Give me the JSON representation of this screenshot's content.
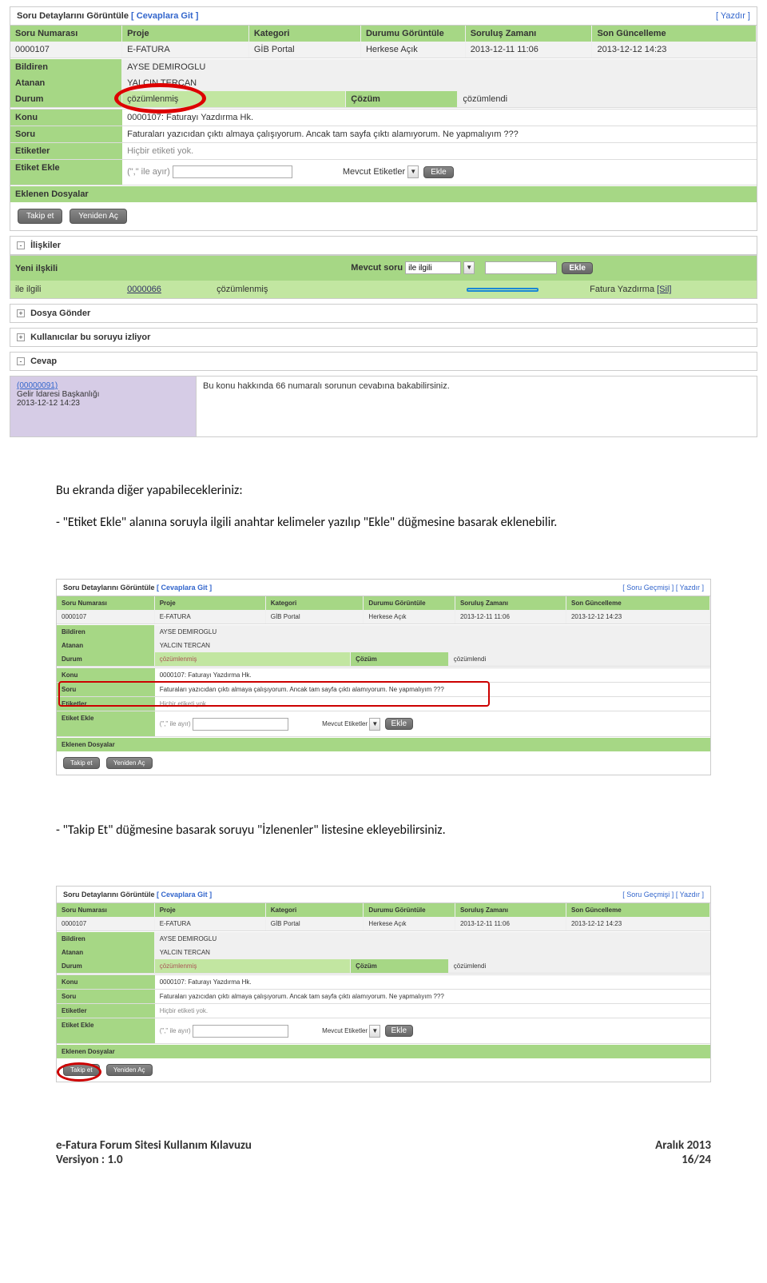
{
  "sc1": {
    "title": "Soru Detaylarını Görüntüle",
    "link_left": "[ Cevaplara Git ]",
    "link_right": "[ Yazdır ]",
    "hdr": {
      "c1": "Soru Numarası",
      "c2": "Proje",
      "c3": "Kategori",
      "c4": "Durumu Görüntüle",
      "c5": "Soruluş Zamanı",
      "c6": "Son Güncelleme"
    },
    "r1": {
      "c1": "0000107",
      "c2": "E-FATURA",
      "c3": "GİB Portal",
      "c4": "Herkese Açık",
      "c5": "2013-12-11 11:06",
      "c6": "2013-12-12 14:23"
    },
    "bildiren_l": "Bildiren",
    "bildiren_v": "AYSE DEMIROGLU",
    "atanan_l": "Atanan",
    "atanan_v": "YALCIN TERCAN",
    "durum_l": "Durum",
    "durum_v": "çözümlenmiş",
    "cozum_l": "Çözüm",
    "cozum_v": "çözümlendi",
    "konu_l": "Konu",
    "konu_v": "0000107: Faturayı Yazdırma Hk.",
    "soru_l": "Soru",
    "soru_v": "Faturaları yazıcıdan çıktı almaya çalışıyorum. Ancak tam sayfa çıktı alamıyorum. Ne yapmalıyım ???",
    "etiket_l": "Etiketler",
    "etiket_v": "Hiçbir etiketi yok.",
    "etiket_ekle_l": "Etiket Ekle",
    "etiket_hint": "(\",\" ile ayır)",
    "mevcut_etiketler": "Mevcut Etiketler",
    "ekle": "Ekle",
    "eklenen_l": "Eklenen Dosyalar",
    "btn_takip": "Takip et",
    "btn_yeniden": "Yeniden Aç",
    "iliskiler": "İlişkiler",
    "yeni_iliskili": "Yeni ilşkili",
    "mevcut_soru": "Mevcut soru",
    "ile_ilgili": "ile ilgili",
    "rel_id": "0000066",
    "rel_status": "çözümlenmiş",
    "rel_title": "Fatura Yazdırma",
    "rel_sil": "[Sil]",
    "dosya_gonder": "Dosya Gönder",
    "kullanicilar": "Kullanıcılar bu soruyu izliyor",
    "cevap_h": "Cevap",
    "cevap_id": "(00000091)",
    "cevap_org": "Gelir İdaresi Başkanlığı",
    "cevap_date": "2013-12-12 14:23",
    "cevap_text": "Bu konu hakkında 66 numaralı sorunun cevabına bakabilirsiniz."
  },
  "body1": "Bu ekranda diğer yapabilecekleriniz:",
  "body2": "-   \"Etiket Ekle\" alanına soruyla ilgili anahtar kelimeler yazılıp \"Ekle\" düğmesine basarak eklenebilir.",
  "sc2": {
    "link_right": "[ Soru Geçmişi ] [ Yazdır ]"
  },
  "body3": "-   \"Takip Et\" düğmesine basarak soruyu \"İzlenenler\" listesine ekleyebilirsiniz.",
  "footer": {
    "left1": "e-Fatura Forum Sitesi Kullanım Kılavuzu",
    "left2": "Versiyon : 1.0",
    "right1": "Aralık 2013",
    "right2": "16/24"
  }
}
